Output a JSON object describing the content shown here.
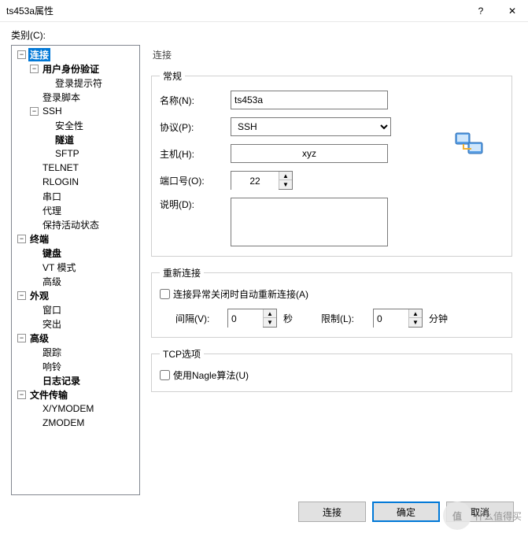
{
  "window": {
    "title": "ts453a属性",
    "help": "?",
    "close": "✕"
  },
  "category_label": "类别(C):",
  "tree": {
    "connection": "连接",
    "user_auth": "用户身份验证",
    "login_prompt": "登录提示符",
    "login_script": "登录脚本",
    "ssh": "SSH",
    "security": "安全性",
    "tunnel": "隧道",
    "sftp": "SFTP",
    "telnet": "TELNET",
    "rlogin": "RLOGIN",
    "serial": "串口",
    "proxy": "代理",
    "keepalive": "保持活动状态",
    "terminal": "终端",
    "keyboard": "键盘",
    "vt_mode": "VT 模式",
    "advanced_term": "高级",
    "appearance": "外观",
    "window": "窗口",
    "highlight": "突出",
    "advanced": "高级",
    "trace": "跟踪",
    "bell": "响铃",
    "logging": "日志记录",
    "file_transfer": "文件传输",
    "xymodem": "X/YMODEM",
    "zmodem": "ZMODEM"
  },
  "panel": {
    "title": "连接",
    "general": {
      "legend": "常规",
      "name_label": "名称(N):",
      "name_value": "ts453a",
      "protocol_label": "协议(P):",
      "protocol_value": "SSH",
      "host_label": "主机(H):",
      "host_value": "xyz",
      "port_label": "端口号(O):",
      "port_value": "22",
      "desc_label": "说明(D):",
      "desc_value": ""
    },
    "reconnect": {
      "legend": "重新连接",
      "auto_label": "连接异常关闭时自动重新连接(A)",
      "interval_label": "间隔(V):",
      "interval_value": "0",
      "interval_unit": "秒",
      "limit_label": "限制(L):",
      "limit_value": "0",
      "limit_unit": "分钟"
    },
    "tcp": {
      "legend": "TCP选项",
      "nagle_label": "使用Nagle算法(U)"
    }
  },
  "buttons": {
    "connect": "连接",
    "ok": "确定",
    "cancel": "取消"
  },
  "watermark": {
    "icon": "值",
    "text": "什么值得买"
  }
}
